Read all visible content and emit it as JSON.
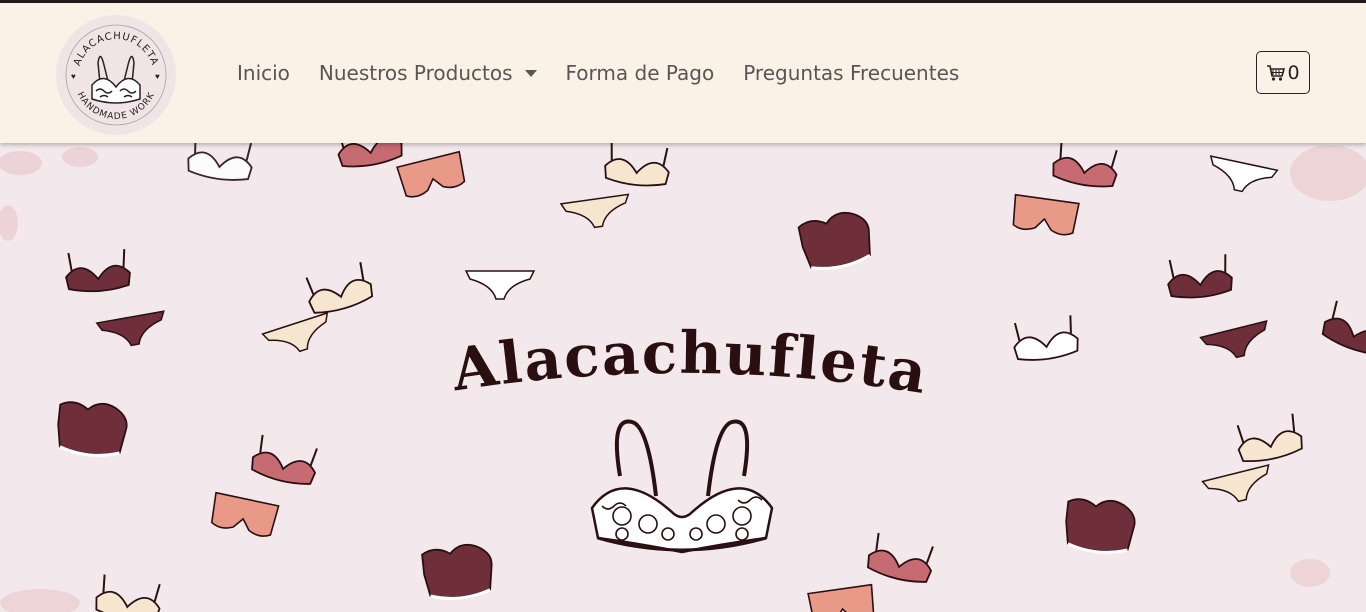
{
  "brand": {
    "logo_ring_text_top": "ALACACHUFLETA",
    "logo_ring_text_bottom": "HANDMADE WORK",
    "hero_title": "Alacachufleta"
  },
  "nav": {
    "items": [
      {
        "label": "Inicio",
        "has_dropdown": false
      },
      {
        "label": "Nuestros Productos",
        "has_dropdown": true
      },
      {
        "label": "Forma de Pago",
        "has_dropdown": false
      },
      {
        "label": "Preguntas Frecuentes",
        "has_dropdown": false
      }
    ]
  },
  "cart": {
    "count": "0",
    "icon": "cart-icon"
  },
  "colors": {
    "navbar_bg": "#faf2e6",
    "hero_bg": "#f3e9ec",
    "dark_plum": "#6e2f3a",
    "rose": "#c76b72",
    "salmon": "#e99987",
    "cream": "#f7e6cf",
    "ink": "#2a0f10"
  }
}
